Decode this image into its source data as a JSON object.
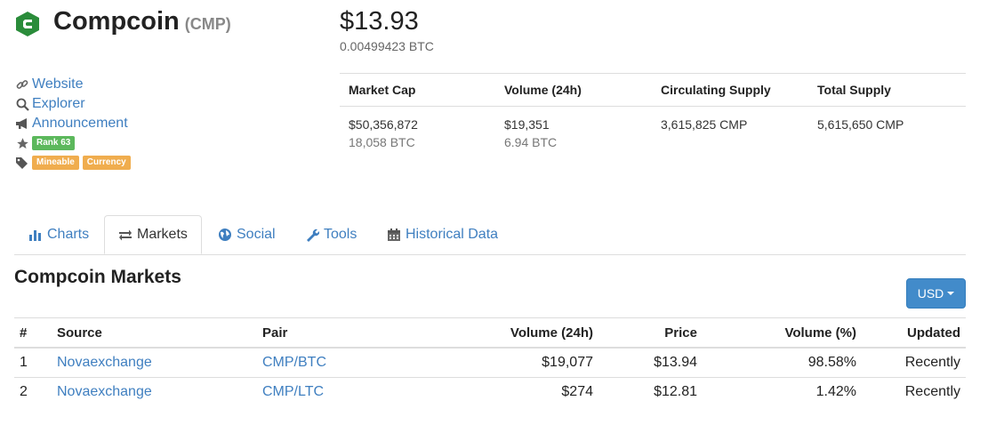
{
  "coin": {
    "name": "Compcoin",
    "symbol": "(CMP)",
    "price_usd": "$13.93",
    "price_btc": "0.00499423 BTC",
    "brand_color": "#2a8c3a"
  },
  "links": {
    "website": "Website",
    "explorer": "Explorer",
    "announcement": "Announcement",
    "rank": "Rank 63",
    "tags": [
      "Mineable",
      "Currency"
    ]
  },
  "stats": {
    "headers": [
      "Market Cap",
      "Volume (24h)",
      "Circulating Supply",
      "Total Supply"
    ],
    "market_cap_usd": "$50,356,872",
    "market_cap_btc": "18,058 BTC",
    "volume_usd": "$19,351",
    "volume_btc": "6.94 BTC",
    "circulating_supply": "3,615,825 CMP",
    "total_supply": "5,615,650 CMP"
  },
  "tabs": {
    "charts": "Charts",
    "markets": "Markets",
    "social": "Social",
    "tools": "Tools",
    "historical": "Historical Data",
    "active": "Markets"
  },
  "markets": {
    "title": "Compcoin Markets",
    "currency_button": "USD",
    "columns": [
      "#",
      "Source",
      "Pair",
      "Volume (24h)",
      "Price",
      "Volume (%)",
      "Updated"
    ],
    "rows": [
      {
        "num": "1",
        "source": "Novaexchange",
        "pair": "CMP/BTC",
        "volume": "$19,077",
        "price": "$13.94",
        "volume_pct": "98.58%",
        "updated": "Recently"
      },
      {
        "num": "2",
        "source": "Novaexchange",
        "pair": "CMP/LTC",
        "volume": "$274",
        "price": "$12.81",
        "volume_pct": "1.42%",
        "updated": "Recently"
      }
    ]
  },
  "colors": {
    "link": "#3f7fc0",
    "rank_label": "#5cb85c",
    "tag_label": "#f0ad4e",
    "button": "#428bca"
  }
}
